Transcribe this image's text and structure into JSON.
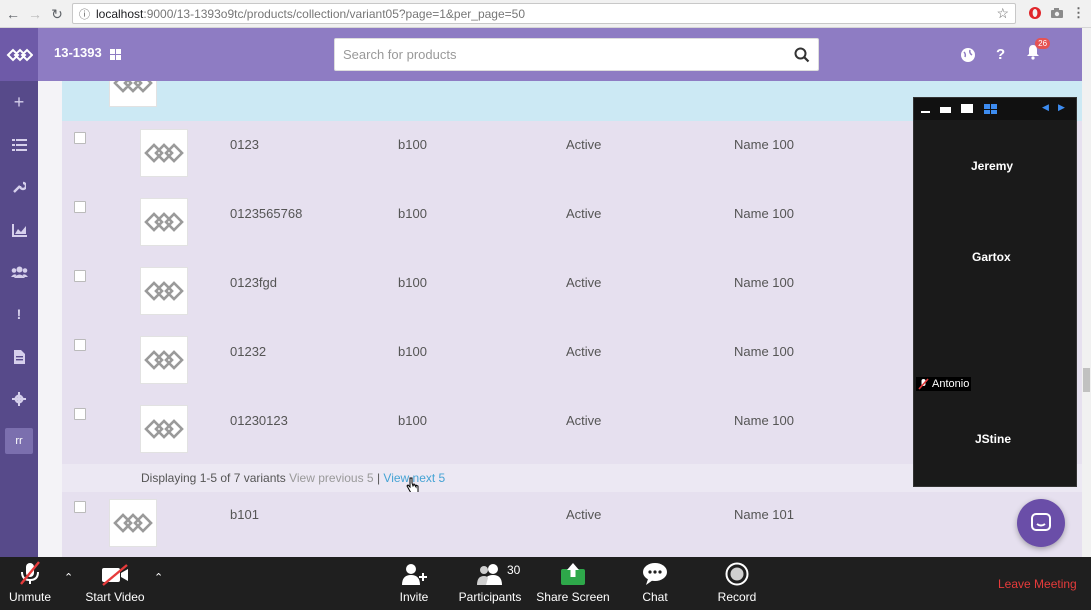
{
  "browser": {
    "url_host": "localhost",
    "url_path": ":9000/13-1393o9tc/products/collection/variant05?page=1&per_page=50"
  },
  "header": {
    "store_name": "13-1393",
    "search_placeholder": "Search for products",
    "notification_count": "26",
    "brand_color": "#8e7cc3"
  },
  "sidebar": {
    "icons": [
      "plus-icon",
      "list-icon",
      "wrench-icon",
      "chart-icon",
      "users-icon",
      "exclamation-icon",
      "document-icon",
      "gear-icon"
    ],
    "active_label": "rr"
  },
  "table": {
    "rows": [
      {
        "sku": "0123",
        "code": "b100",
        "status": "Active",
        "name": "Name 100"
      },
      {
        "sku": "0123565768",
        "code": "b100",
        "status": "Active",
        "name": "Name 100"
      },
      {
        "sku": "0123fgd",
        "code": "b100",
        "status": "Active",
        "name": "Name 100"
      },
      {
        "sku": "01232",
        "code": "b100",
        "status": "Active",
        "name": "Name 100"
      },
      {
        "sku": "01230123",
        "code": "b100",
        "status": "Active",
        "name": "Name 100"
      }
    ],
    "pager": {
      "displaying": "Displaying 1-5 of 7 variants",
      "prev": "View previous 5",
      "sep": "|",
      "next": "View next 5"
    },
    "extra_row": {
      "sku": "b101",
      "code": "",
      "status": "Active",
      "name": "Name 101"
    }
  },
  "participants_panel": {
    "names": [
      "Jeremy",
      "Gartox",
      "Antonio",
      "JStine"
    ]
  },
  "meeting_bar": {
    "unmute": "Unmute",
    "start_video": "Start Video",
    "invite": "Invite",
    "participants": "Participants",
    "participants_count": "30",
    "share_screen": "Share Screen",
    "chat": "Chat",
    "record": "Record",
    "leave": "Leave Meeting"
  }
}
